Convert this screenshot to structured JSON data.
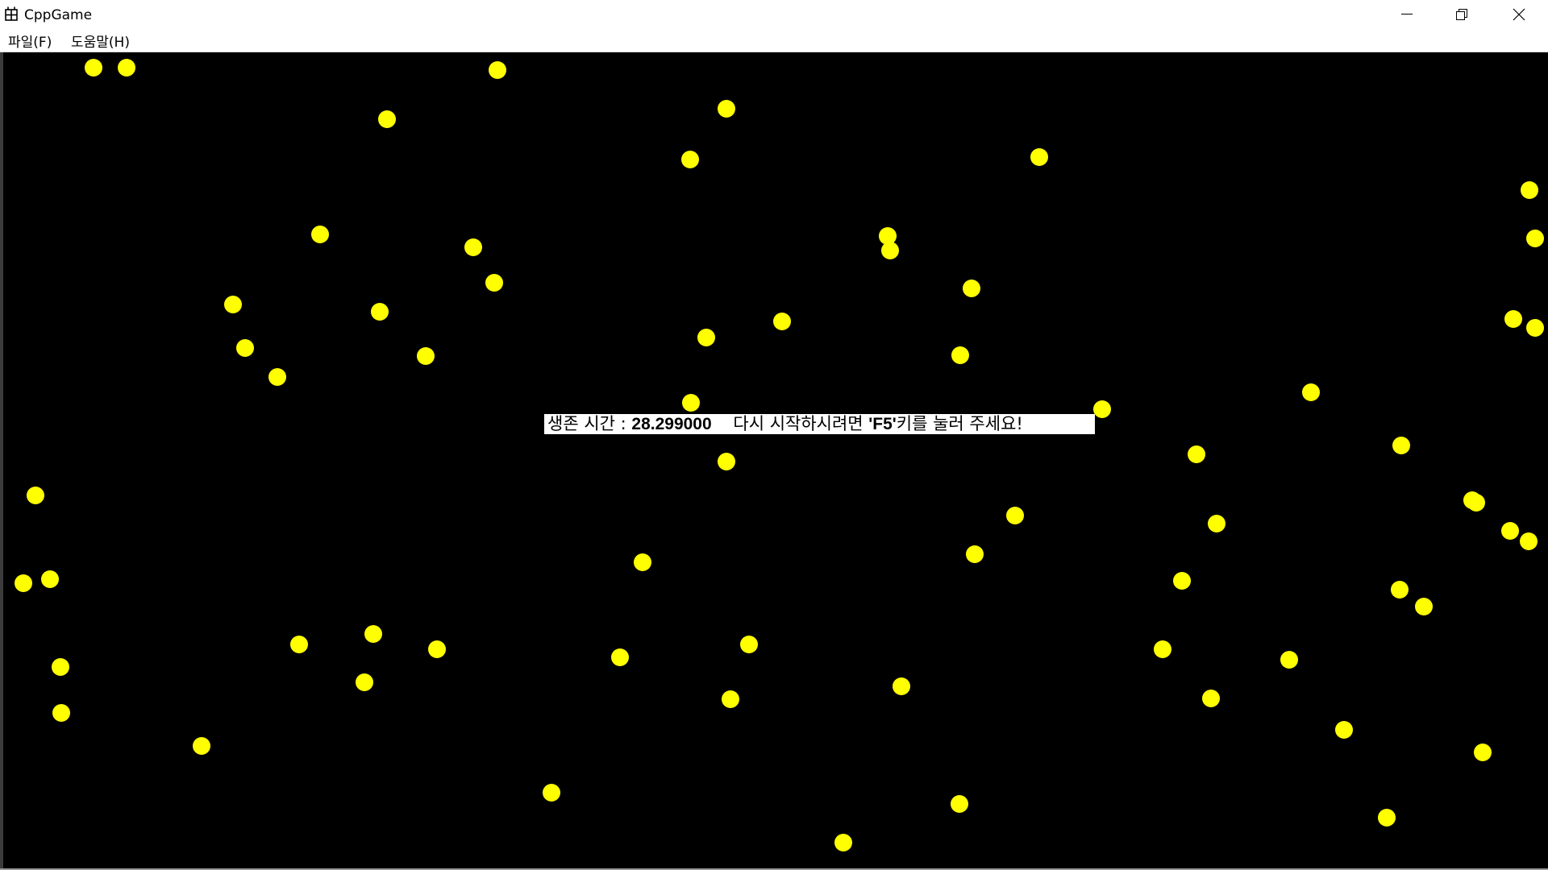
{
  "window": {
    "title": "CppGame",
    "icon": "app-grid-icon",
    "minimize_icon": "minimize-icon",
    "maximize_icon": "restore-icon",
    "close_icon": "close-icon"
  },
  "menu": {
    "items": [
      {
        "label": "파일(F)"
      },
      {
        "label": "도움말(H)"
      }
    ]
  },
  "game": {
    "background_color": "#000000",
    "ball_color": "#ffff00",
    "message": {
      "survival_label": "생존 시간 : ",
      "survival_time": "28.299000",
      "restart_prefix": "    다시 시작하시려면 ",
      "key": "'F5'",
      "restart_suffix": "키를 눌러 주세요!"
    }
  }
}
